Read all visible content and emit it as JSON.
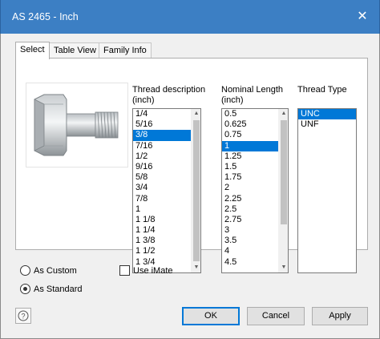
{
  "window": {
    "title": "AS 2465 - Inch",
    "close_glyph": "✕"
  },
  "tabs": [
    {
      "label": "Select",
      "active": true
    },
    {
      "label": "Table View",
      "active": false
    },
    {
      "label": "Family Info",
      "active": false
    }
  ],
  "preview": {
    "icon": "hex-bolt-image"
  },
  "thread_description": {
    "label_line1": "Thread description",
    "label_line2": "(inch)",
    "items": [
      "1/4",
      "5/16",
      "3/8",
      "7/16",
      "1/2",
      "9/16",
      "5/8",
      "3/4",
      "7/8",
      "1",
      "1 1/8",
      "1 1/4",
      "1 3/8",
      "1 1/2",
      "1 3/4"
    ],
    "selected": "3/8"
  },
  "nominal_length": {
    "label_line1": "Nominal Length",
    "label_line2": "(inch)",
    "items": [
      "0.5",
      "0.625",
      "0.75",
      "1",
      "1.25",
      "1.5",
      "1.75",
      "2",
      "2.25",
      "2.5",
      "2.75",
      "3",
      "3.5",
      "4",
      "4.5"
    ],
    "selected": "1"
  },
  "thread_type": {
    "label": "Thread Type",
    "items": [
      "UNC",
      "UNF"
    ],
    "selected": "UNC"
  },
  "options": {
    "as_custom": {
      "label": "As Custom",
      "checked": false
    },
    "as_standard": {
      "label": "As Standard",
      "checked": true
    },
    "use_imate": {
      "label": "Use iMate",
      "checked": false
    }
  },
  "buttons": {
    "ok": "OK",
    "cancel": "Cancel",
    "apply": "Apply",
    "help_icon": "help-icon"
  },
  "colors": {
    "titlebar": "#3c7fc4",
    "selection": "#0078d7",
    "default_button_border": "#0078d7"
  }
}
